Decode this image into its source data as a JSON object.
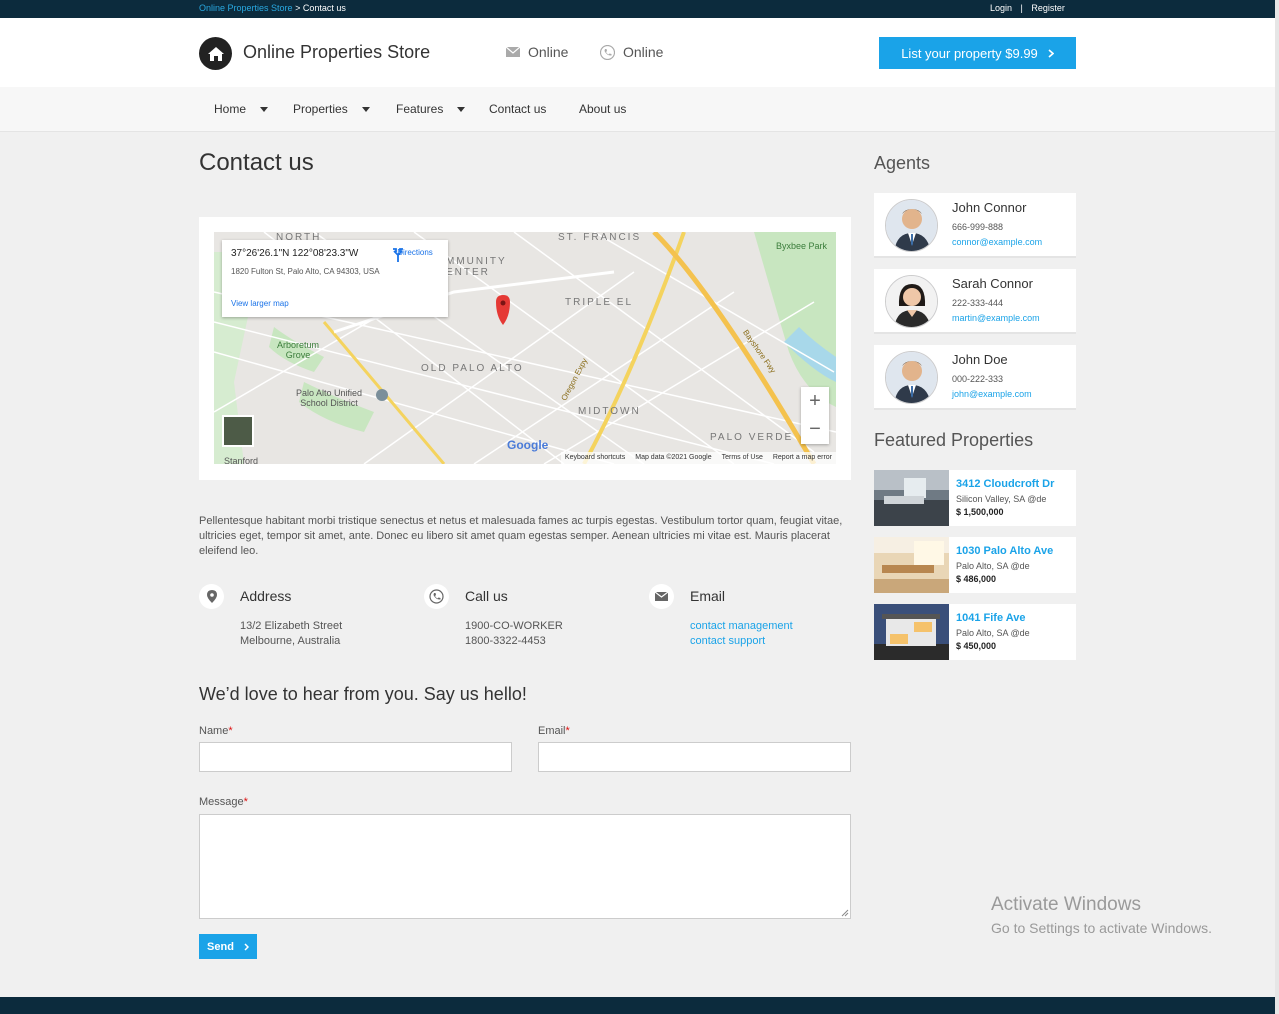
{
  "topbar": {
    "breadcrumb_home": "Online Properties Store",
    "breadcrumb_current": "> Contact us",
    "login": "Login",
    "separator": "|",
    "register": "Register"
  },
  "header": {
    "site_title": "Online Properties Store",
    "contact_email_label": "Online",
    "contact_phone_label": "Online",
    "cta_label": "List your property $9.99"
  },
  "nav": {
    "items": [
      {
        "label": "Home",
        "has_dropdown": true
      },
      {
        "label": "Properties",
        "has_dropdown": true
      },
      {
        "label": "Features",
        "has_dropdown": true
      },
      {
        "label": "Contact us",
        "has_dropdown": false
      },
      {
        "label": "About us",
        "has_dropdown": false
      }
    ]
  },
  "page": {
    "title": "Contact us",
    "intro": "Pellentesque habitant morbi tristique senectus et netus et malesuada fames ac turpis egestas. Vestibulum tortor quam, feugiat vitae, ultricies eget, tempor sit amet, ante. Donec eu libero sit amet quam egestas semper. Aenean ultricies mi vitae est. Mauris placerat eleifend leo."
  },
  "map": {
    "coords": "37°26'26.1\"N 122°08'23.3\"W",
    "address": "1820 Fulton St, Palo Alto, CA 94303, USA",
    "view_larger": "View larger map",
    "directions": "Directions",
    "zoom_in": "+",
    "zoom_out": "−",
    "google": "Google",
    "footer": [
      "Keyboard shortcuts",
      "Map data ©2021 Google",
      "Terms of Use",
      "Report a map error"
    ],
    "labels": {
      "old_palo_alto": "OLD PALO ALTO",
      "midtown": "MIDTOWN",
      "triple_el": "TRIPLE EL",
      "palo_verde": "PALO VERDE",
      "st_francis": "ST. FRANCIS",
      "community_center": "MMUNITY\nENTER",
      "north": "NORTH",
      "arboretum": "Arboretum\nGrove",
      "school_district": "Palo Alto Unified\nSchool District",
      "byxbee": "Byxbee Park",
      "oregon_expy": "Oregon Expy",
      "bayshore": "Bayshore Fwy",
      "stanford": "Stanford"
    }
  },
  "contact_info": {
    "address": {
      "title": "Address",
      "line1": "13/2 Elizabeth Street",
      "line2": "Melbourne, Australia"
    },
    "call": {
      "title": "Call us",
      "line1": "1900-CO-WORKER",
      "line2": "1800-3322-4453"
    },
    "email": {
      "title": "Email",
      "link1": "contact management",
      "link2": "contact support"
    }
  },
  "form": {
    "heading": "We’d love to hear from you. Say us hello!",
    "name_label": "Name",
    "email_label": "Email",
    "message_label": "Message",
    "required_mark": "*",
    "send_label": "Send"
  },
  "sidebar": {
    "agents_title": "Agents",
    "agents": [
      {
        "name": "John Connor",
        "phone": "666-999-888",
        "email": "connor@example.com"
      },
      {
        "name": "Sarah Connor",
        "phone": "222-333-444",
        "email": "martin@example.com"
      },
      {
        "name": "John Doe",
        "phone": "000-222-333",
        "email": "john@example.com"
      }
    ],
    "featured_title": "Featured Properties",
    "properties": [
      {
        "name": "3412 Cloudcroft Dr",
        "location": "Silicon Valley, SA @de",
        "price": "$ 1,500,000"
      },
      {
        "name": "1030 Palo Alto Ave",
        "location": "Palo Alto, SA @de",
        "price": "$ 486,000"
      },
      {
        "name": "1041 Fife Ave",
        "location": "Palo Alto, SA @de",
        "price": "$ 450,000"
      }
    ]
  },
  "watermark": {
    "line1": "Activate Windows",
    "line2": "Go to Settings to activate Windows."
  },
  "colors": {
    "accent": "#1aa3e8",
    "topbar": "#0c2b3d",
    "page_bg": "#f0f0f0"
  }
}
